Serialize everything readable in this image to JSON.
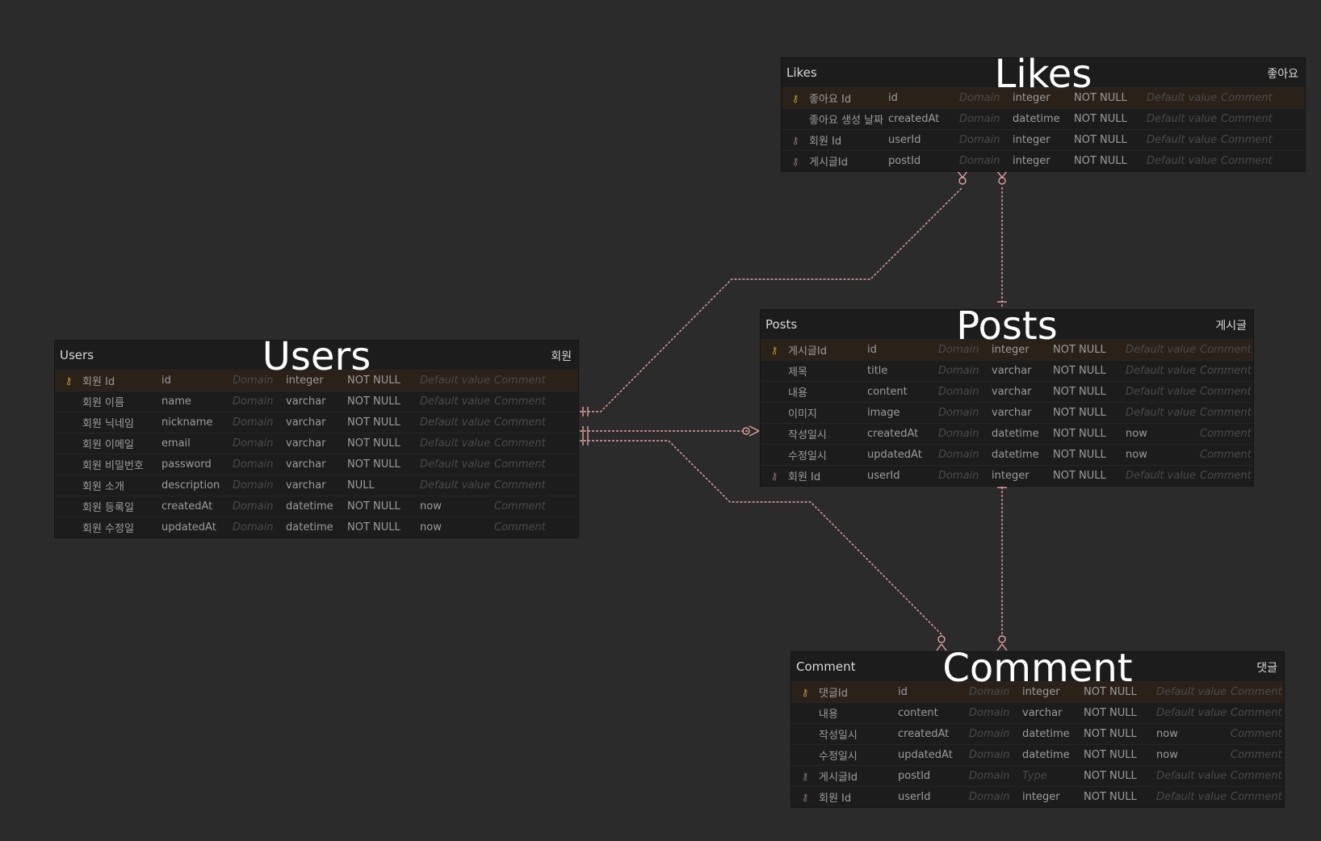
{
  "colors": {
    "background": "#2b2b2b",
    "table": "#1c1c1c",
    "relation": "#e3a2a2",
    "pk_icon": "#b99a3a"
  },
  "tables": {
    "likes": {
      "name": "Likes",
      "comment": "좋아요",
      "big_label": "Likes",
      "columns": [
        {
          "key": "pk",
          "logical": "좋아요 Id",
          "physical": "id",
          "domain": "Domain",
          "type": "integer",
          "nullable": "NOT NULL",
          "default": "Default value",
          "comment": "Comment"
        },
        {
          "key": "",
          "logical": "좋아요 생성 날짜",
          "physical": "createdAt",
          "domain": "Domain",
          "type": "datetime",
          "nullable": "NOT NULL",
          "default": "Default value",
          "comment": "Comment"
        },
        {
          "key": "fk",
          "logical": "회원 Id",
          "physical": "userId",
          "domain": "Domain",
          "type": "integer",
          "nullable": "NOT NULL",
          "default": "Default value",
          "comment": "Comment"
        },
        {
          "key": "fk",
          "logical": "게시글Id",
          "physical": "postId",
          "domain": "Domain",
          "type": "integer",
          "nullable": "NOT NULL",
          "default": "Default value",
          "comment": "Comment"
        }
      ]
    },
    "users": {
      "name": "Users",
      "comment": "회원",
      "big_label": "Users",
      "columns": [
        {
          "key": "pk",
          "logical": "회원 Id",
          "physical": "id",
          "domain": "Domain",
          "type": "integer",
          "nullable": "NOT NULL",
          "default": "Default value",
          "comment": "Comment"
        },
        {
          "key": "",
          "logical": "회원 이름",
          "physical": "name",
          "domain": "Domain",
          "type": "varchar",
          "nullable": "NOT NULL",
          "default": "Default value",
          "comment": "Comment"
        },
        {
          "key": "",
          "logical": "회원 닉네임",
          "physical": "nickname",
          "domain": "Domain",
          "type": "varchar",
          "nullable": "NOT NULL",
          "default": "Default value",
          "comment": "Comment"
        },
        {
          "key": "",
          "logical": "회원 이메일",
          "physical": "email",
          "domain": "Domain",
          "type": "varchar",
          "nullable": "NOT NULL",
          "default": "Default value",
          "comment": "Comment"
        },
        {
          "key": "",
          "logical": "회원 비밀번호",
          "physical": "password",
          "domain": "Domain",
          "type": "varchar",
          "nullable": "NOT NULL",
          "default": "Default value",
          "comment": "Comment"
        },
        {
          "key": "",
          "logical": "회원 소개",
          "physical": "description",
          "domain": "Domain",
          "type": "varchar",
          "nullable": "NULL",
          "default": "Default value",
          "comment": "Comment"
        },
        {
          "key": "",
          "logical": "회원 등록일",
          "physical": "createdAt",
          "domain": "Domain",
          "type": "datetime",
          "nullable": "NOT NULL",
          "default": "now",
          "comment": "Comment"
        },
        {
          "key": "",
          "logical": "회원 수정일",
          "physical": "updatedAt",
          "domain": "Domain",
          "type": "datetime",
          "nullable": "NOT NULL",
          "default": "now",
          "comment": "Comment"
        }
      ]
    },
    "posts": {
      "name": "Posts",
      "comment": "게시글",
      "big_label": "Posts",
      "columns": [
        {
          "key": "pk",
          "logical": "게시글Id",
          "physical": "id",
          "domain": "Domain",
          "type": "integer",
          "nullable": "NOT NULL",
          "default": "Default value",
          "comment": "Comment"
        },
        {
          "key": "",
          "logical": "제목",
          "physical": "title",
          "domain": "Domain",
          "type": "varchar",
          "nullable": "NOT NULL",
          "default": "Default value",
          "comment": "Comment"
        },
        {
          "key": "",
          "logical": "내용",
          "physical": "content",
          "domain": "Domain",
          "type": "varchar",
          "nullable": "NOT NULL",
          "default": "Default value",
          "comment": "Comment"
        },
        {
          "key": "",
          "logical": "이미지",
          "physical": "image",
          "domain": "Domain",
          "type": "varchar",
          "nullable": "NOT NULL",
          "default": "Default value",
          "comment": "Comment"
        },
        {
          "key": "",
          "logical": "작성일시",
          "physical": "createdAt",
          "domain": "Domain",
          "type": "datetime",
          "nullable": "NOT NULL",
          "default": "now",
          "comment": "Comment"
        },
        {
          "key": "",
          "logical": "수정일시",
          "physical": "updatedAt",
          "domain": "Domain",
          "type": "datetime",
          "nullable": "NOT NULL",
          "default": "now",
          "comment": "Comment"
        },
        {
          "key": "fk",
          "logical": "회원 Id",
          "physical": "userId",
          "domain": "Domain",
          "type": "integer",
          "nullable": "NOT NULL",
          "default": "Default value",
          "comment": "Comment"
        }
      ]
    },
    "comment": {
      "name": "Comment",
      "comment": "댓글",
      "big_label": "Comment",
      "columns": [
        {
          "key": "pk",
          "logical": "댓글Id",
          "physical": "id",
          "domain": "Domain",
          "type": "integer",
          "nullable": "NOT NULL",
          "default": "Default value",
          "comment": "Comment"
        },
        {
          "key": "",
          "logical": "내용",
          "physical": "content",
          "domain": "Domain",
          "type": "varchar",
          "nullable": "NOT NULL",
          "default": "Default value",
          "comment": "Comment"
        },
        {
          "key": "",
          "logical": "작성일시",
          "physical": "createdAt",
          "domain": "Domain",
          "type": "datetime",
          "nullable": "NOT NULL",
          "default": "now",
          "comment": "Comment"
        },
        {
          "key": "",
          "logical": "수정일시",
          "physical": "updatedAt",
          "domain": "Domain",
          "type": "datetime",
          "nullable": "NOT NULL",
          "default": "now",
          "comment": "Comment"
        },
        {
          "key": "fk",
          "logical": "게시글Id",
          "physical": "postId",
          "domain": "Domain",
          "type": "Type",
          "nullable": "NOT NULL",
          "default": "Default value",
          "comment": "Comment"
        },
        {
          "key": "fk",
          "logical": "회원 Id",
          "physical": "userId",
          "domain": "Domain",
          "type": "integer",
          "nullable": "NOT NULL",
          "default": "Default value",
          "comment": "Comment"
        }
      ]
    }
  }
}
